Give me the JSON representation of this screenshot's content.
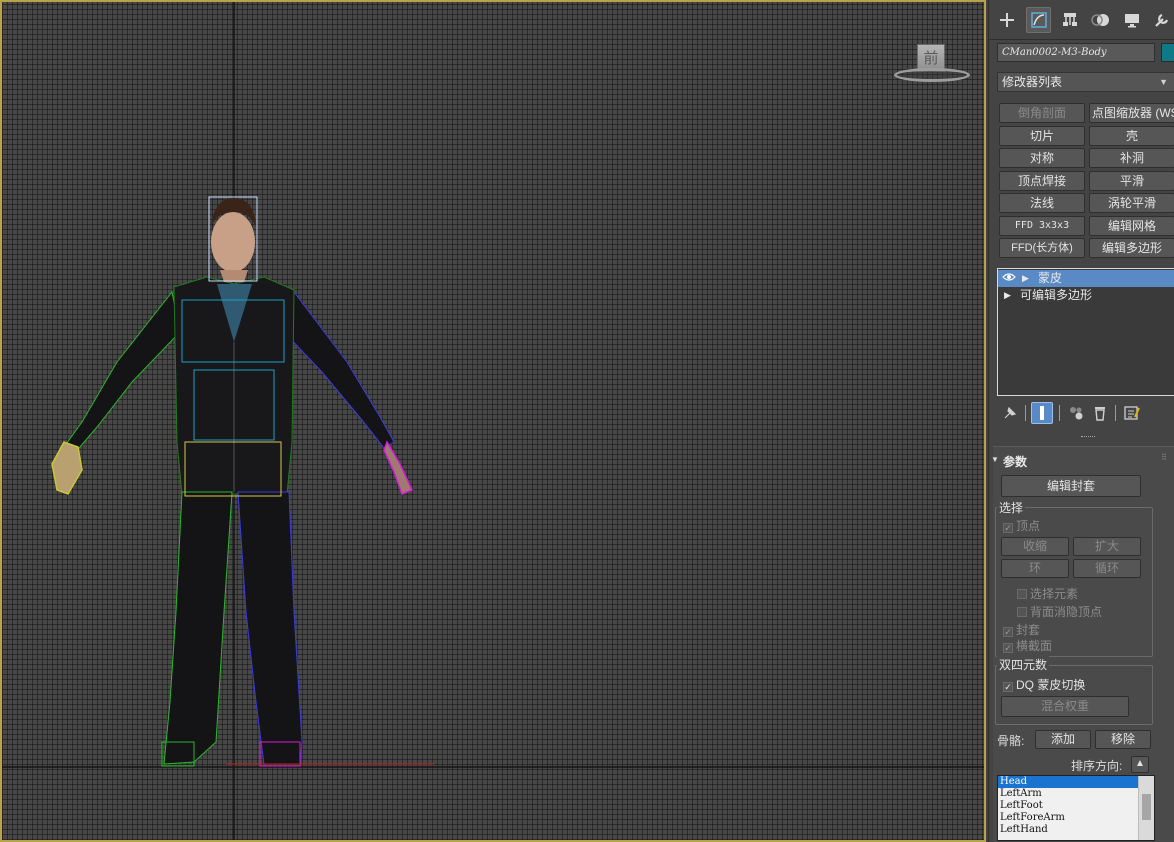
{
  "viewport": {
    "view_label": "前",
    "border_color": "#b8a24a"
  },
  "panel": {
    "tabs": [
      {
        "icon": "create-plus-icon"
      },
      {
        "icon": "modify-icon",
        "active": true
      },
      {
        "icon": "hierarchy-icon"
      },
      {
        "icon": "motion-icon"
      },
      {
        "icon": "display-icon"
      },
      {
        "icon": "utilities-wrench-icon"
      }
    ],
    "object_name": "CMan0002-M3-Body",
    "object_color": "#0e7a88",
    "modifier_list_label": "修改器列表",
    "modifier_buttons": [
      {
        "label": "倒角剖面",
        "dim": true
      },
      {
        "label": "点图缩放器 (WSM)",
        "dim": false
      },
      {
        "label": "切片",
        "dim": false
      },
      {
        "label": "壳",
        "dim": false
      },
      {
        "label": "对称",
        "dim": false
      },
      {
        "label": "补洞",
        "dim": false
      },
      {
        "label": "顶点焊接",
        "dim": false
      },
      {
        "label": "平滑",
        "dim": false
      },
      {
        "label": "法线",
        "dim": false
      },
      {
        "label": "涡轮平滑",
        "dim": false
      },
      {
        "label": "FFD 3x3x3",
        "dim": false
      },
      {
        "label": "编辑网格",
        "dim": false
      },
      {
        "label": "FFD(长方体)",
        "dim": false
      },
      {
        "label": "编辑多边形",
        "dim": false
      }
    ],
    "stack": [
      {
        "label": "蒙皮",
        "selected": true
      },
      {
        "label": "可编辑多边形",
        "selected": false
      }
    ],
    "rollout": {
      "title": "参数",
      "edit_envelopes": "编辑封套",
      "select_group": "选择",
      "vertices": "顶点",
      "shrink": "收缩",
      "grow": "扩大",
      "ring": "环",
      "loop": "循环",
      "select_element": "选择元素",
      "backface_cull": "背面消隐顶点",
      "envelopes": "封套",
      "cross_sections": "横截面",
      "dq_group": "双四元数",
      "dq_toggle": "DQ 蒙皮切换",
      "blend_weights": "混合权重",
      "bones_label": "骨骼:",
      "add": "添加",
      "remove": "移除",
      "sort_direction": "排序方向:",
      "bones": [
        "Head",
        "LeftArm",
        "LeftFoot",
        "LeftForeArm",
        "LeftHand"
      ],
      "selected_bone": "Head"
    }
  }
}
